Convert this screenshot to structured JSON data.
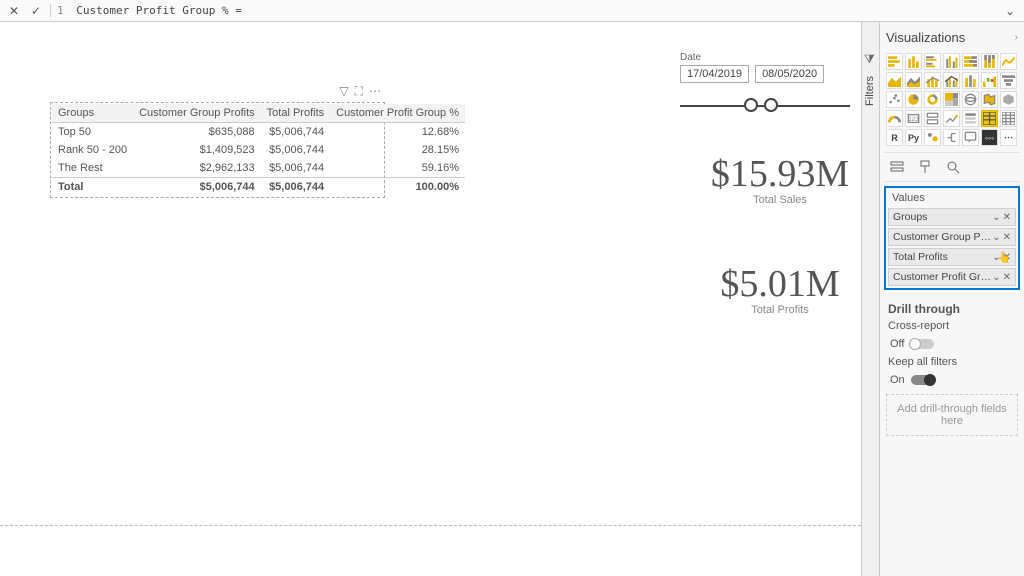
{
  "formula_bar": {
    "line_no": "1",
    "text": "Customer Profit Group % ="
  },
  "canvas": {
    "date_slicer": {
      "label": "Date",
      "from": "17/04/2019",
      "to": "08/05/2020"
    },
    "cards": {
      "sales": {
        "value": "$15.93M",
        "label": "Total Sales"
      },
      "profits": {
        "value": "$5.01M",
        "label": "Total Profits"
      }
    },
    "table": {
      "columns": [
        "Groups",
        "Customer Group Profits",
        "Total Profits",
        "Customer Profit Group %"
      ],
      "rows": [
        {
          "c0": "Top 50",
          "c1": "$635,088",
          "c2": "$5,006,744",
          "c3": "12.68%"
        },
        {
          "c0": "Rank 50 - 200",
          "c1": "$1,409,523",
          "c2": "$5,006,744",
          "c3": "28.15%"
        },
        {
          "c0": "The Rest",
          "c1": "$2,962,133",
          "c2": "$5,006,744",
          "c3": "59.16%"
        }
      ],
      "total": {
        "c0": "Total",
        "c1": "$5,006,744",
        "c2": "$5,006,744",
        "c3": "100.00%"
      }
    }
  },
  "right_panel": {
    "title": "Visualizations",
    "values_header": "Values",
    "fields": [
      {
        "label": "Groups"
      },
      {
        "label": "Customer Group Profits"
      },
      {
        "label": "Total Profits"
      },
      {
        "label": "Customer Profit Group %"
      }
    ],
    "drill": {
      "title": "Drill through",
      "cross_label": "Cross-report",
      "cross_state": "Off",
      "keep_label": "Keep all filters",
      "keep_state": "On",
      "drop_hint": "Add drill-through fields here"
    }
  },
  "filters_tab": {
    "label": "Filters"
  },
  "chart_data": {
    "type": "table",
    "title": "Customer Profit Group %",
    "columns": [
      "Groups",
      "Customer Group Profits",
      "Total Profits",
      "Customer Profit Group %"
    ],
    "rows": [
      [
        "Top 50",
        635088,
        5006744,
        12.68
      ],
      [
        "Rank 50 - 200",
        1409523,
        5006744,
        28.15
      ],
      [
        "The Rest",
        2962133,
        5006744,
        59.16
      ]
    ],
    "total": [
      "Total",
      5006744,
      5006744,
      100.0
    ],
    "cards": [
      {
        "label": "Total Sales",
        "value": 15930000
      },
      {
        "label": "Total Profits",
        "value": 5010000
      }
    ],
    "date_range": [
      "2019-04-17",
      "2020-05-08"
    ]
  }
}
